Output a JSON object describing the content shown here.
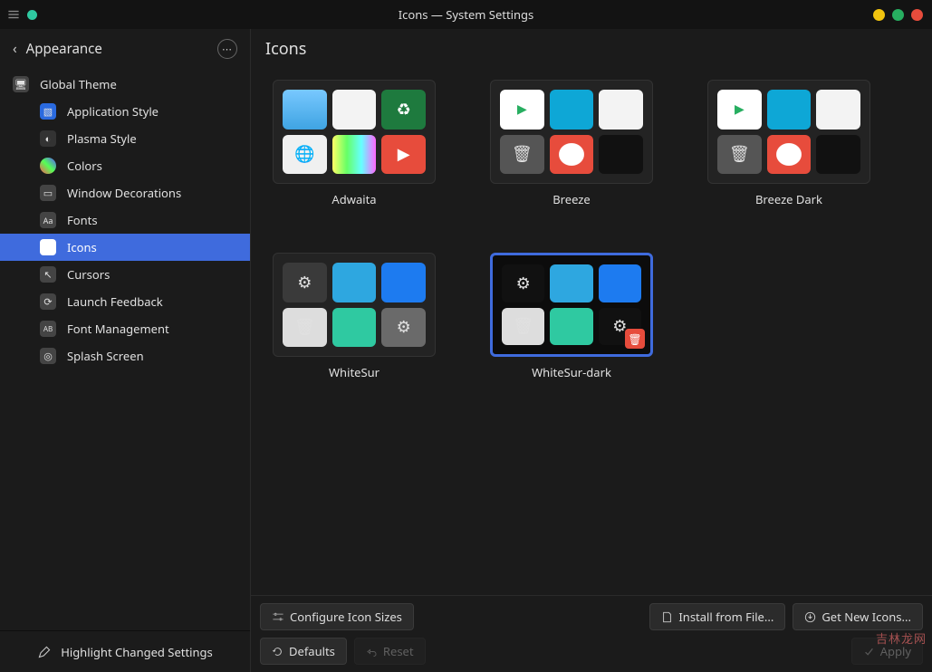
{
  "window": {
    "title": "Icons — System Settings"
  },
  "sidebar": {
    "back_label": "Appearance",
    "items": [
      {
        "label": "Global Theme",
        "icon": "monitor-icon"
      },
      {
        "label": "Application Style",
        "icon": "cube-icon"
      },
      {
        "label": "Plasma Style",
        "icon": "plasma-icon"
      },
      {
        "label": "Colors",
        "icon": "palette-icon"
      },
      {
        "label": "Window Decorations",
        "icon": "window-icon"
      },
      {
        "label": "Fonts",
        "icon": "fonts-icon"
      },
      {
        "label": "Icons",
        "icon": "apple-icon",
        "selected": true
      },
      {
        "label": "Cursors",
        "icon": "cursor-icon"
      },
      {
        "label": "Launch Feedback",
        "icon": "launch-icon"
      },
      {
        "label": "Font Management",
        "icon": "font-mgmt-icon"
      },
      {
        "label": "Splash Screen",
        "icon": "splash-icon"
      }
    ],
    "footer": {
      "highlight_label": "Highlight Changed Settings"
    }
  },
  "content": {
    "heading": "Icons",
    "themes": [
      {
        "name": "Adwaita",
        "selected": false,
        "accent": "light"
      },
      {
        "name": "Breeze",
        "selected": false,
        "accent": "breeze"
      },
      {
        "name": "Breeze Dark",
        "selected": false,
        "accent": "breeze"
      },
      {
        "name": "WhiteSur",
        "selected": false,
        "accent": "mac"
      },
      {
        "name": "WhiteSur-dark",
        "selected": true,
        "accent": "mac-dark",
        "removable": true
      }
    ],
    "footer": {
      "configure_label": "Configure Icon Sizes",
      "install_label": "Install from File...",
      "getnew_label": "Get New Icons...",
      "defaults_label": "Defaults",
      "reset_label": "Reset",
      "apply_label": "Apply"
    }
  },
  "watermark": "吉林龙网"
}
